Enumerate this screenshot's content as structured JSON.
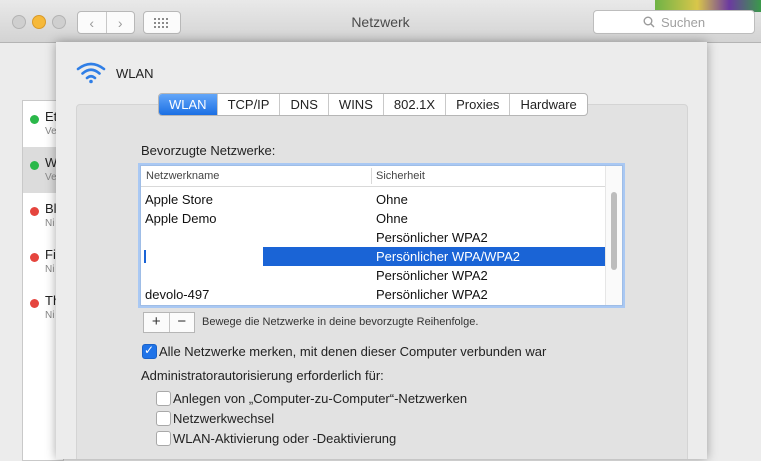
{
  "window": {
    "title": "Netzwerk"
  },
  "search": {
    "placeholder": "Suchen"
  },
  "services": [
    {
      "name": "Et",
      "sub": "Ve",
      "status_color": "#2bb84a"
    },
    {
      "name": "W",
      "sub": "Ve",
      "status_color": "#2bb84a",
      "selected": true
    },
    {
      "name": "Bl",
      "sub": "Ni",
      "status_color": "#e5453e"
    },
    {
      "name": "Fi",
      "sub": "Ni",
      "status_color": "#e5453e"
    },
    {
      "name": "Th",
      "sub": "Ni",
      "status_color": "#e5453e"
    }
  ],
  "sheet": {
    "title": "WLAN",
    "tabs": [
      {
        "label": "WLAN",
        "active": true
      },
      {
        "label": "TCP/IP"
      },
      {
        "label": "DNS"
      },
      {
        "label": "WINS"
      },
      {
        "label": "802.1X"
      },
      {
        "label": "Proxies"
      },
      {
        "label": "Hardware"
      }
    ],
    "preferred_label": "Bevorzugte Netzwerke:",
    "table": {
      "columns": [
        "Netzwerkname",
        "Sicherheit"
      ],
      "rows": [
        {
          "name": "Apple Store",
          "security": "Ohne"
        },
        {
          "name": "Apple Demo",
          "security": "Ohne"
        },
        {
          "name": "",
          "security": "Persönlicher WPA2"
        },
        {
          "name": "",
          "security": "Persönlicher WPA/WPA2",
          "selected": true
        },
        {
          "name": "",
          "security": "Persönlicher WPA2"
        },
        {
          "name": "devolo-497",
          "security": "Persönlicher WPA2"
        }
      ]
    },
    "plus": "+",
    "minus": "−",
    "reorder_hint": "Bewege die Netzwerke in deine bevorzugte Reihenfolge.",
    "remember_label": "Alle Netzwerke merken, mit denen dieser Computer verbunden war",
    "remember_checked": true,
    "admin_label": "Administratorautorisierung erforderlich für:",
    "admin_options": [
      {
        "label": "Anlegen von „Computer-zu-Computer“-Netzwerken",
        "checked": false
      },
      {
        "label": "Netzwerkwechsel",
        "checked": false
      },
      {
        "label": "WLAN-Aktivierung oder -Deaktivierung",
        "checked": false
      }
    ]
  }
}
